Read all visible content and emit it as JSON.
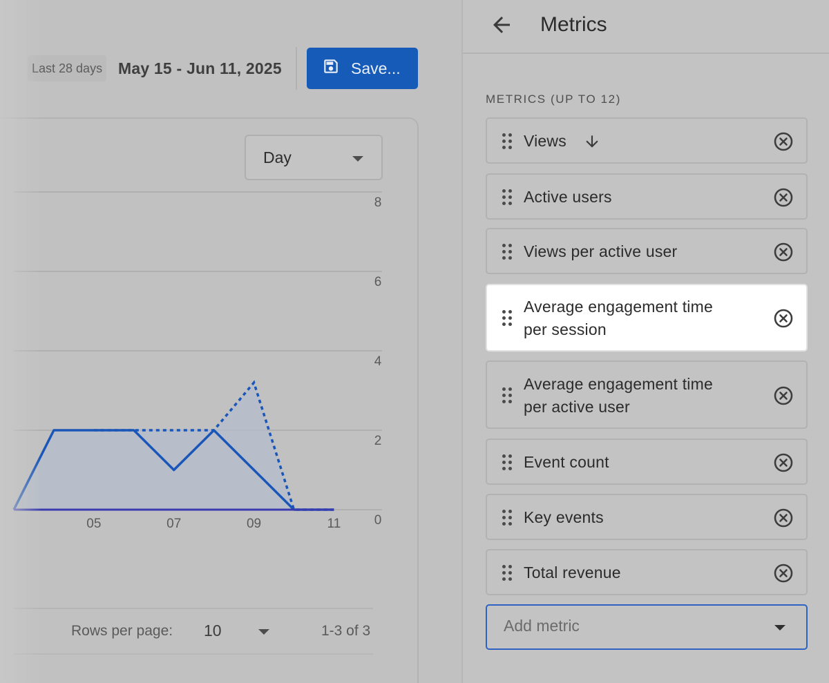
{
  "header": {
    "date_chip": "Last 28 days",
    "date_range": "May 15 - Jun 11, 2025",
    "save_label": "Save..."
  },
  "report": {
    "granularity": "Day",
    "rows_per_page_label": "Rows per page:",
    "rows_per_page_value": "10",
    "pagination": "1-3 of 3"
  },
  "chart_data": {
    "type": "area",
    "x_ticks": [
      "05",
      "07",
      "09",
      "11"
    ],
    "y_ticks": [
      "8",
      "6",
      "4",
      "2",
      "0"
    ],
    "ylim": [
      0,
      8
    ],
    "xlim": [
      3.0,
      11.2
    ],
    "series": [
      {
        "style": "solid",
        "x": [
          3,
          4,
          5,
          6,
          7,
          8,
          9,
          10,
          11
        ],
        "values": [
          0,
          2,
          2,
          2,
          1,
          2,
          1,
          0,
          0
        ]
      },
      {
        "style": "dashed",
        "x": [
          5,
          6,
          7,
          8,
          9,
          10,
          11
        ],
        "values": [
          2,
          2,
          2,
          2,
          3.2,
          0,
          0
        ]
      },
      {
        "style": "baseline",
        "x": [
          3,
          11
        ],
        "values": [
          0,
          0
        ]
      }
    ],
    "grid": true,
    "colors": {
      "line": "#1a56b8",
      "fill": "#b4bccb",
      "baseline": "#3b3bb0"
    }
  },
  "panel": {
    "title": "Metrics",
    "section_label": "METRICS (UP TO 12)",
    "metrics": [
      {
        "line1": "Views",
        "line2": ""
      },
      {
        "line1": "Active users",
        "line2": ""
      },
      {
        "line1": "Views per active user",
        "line2": ""
      },
      {
        "line1": "Average engagement time",
        "line2": "per session"
      },
      {
        "line1": "Average engagement time",
        "line2": "per active user"
      },
      {
        "line1": "Event count",
        "line2": ""
      },
      {
        "line1": "Key events",
        "line2": ""
      },
      {
        "line1": "Total revenue",
        "line2": ""
      }
    ],
    "add_placeholder": "Add metric"
  },
  "icons": [
    "back-arrow-icon",
    "save-icon",
    "drag-handle-icon",
    "sort-down-arrow-icon",
    "remove-circle-icon",
    "dropdown-caret-icon"
  ]
}
